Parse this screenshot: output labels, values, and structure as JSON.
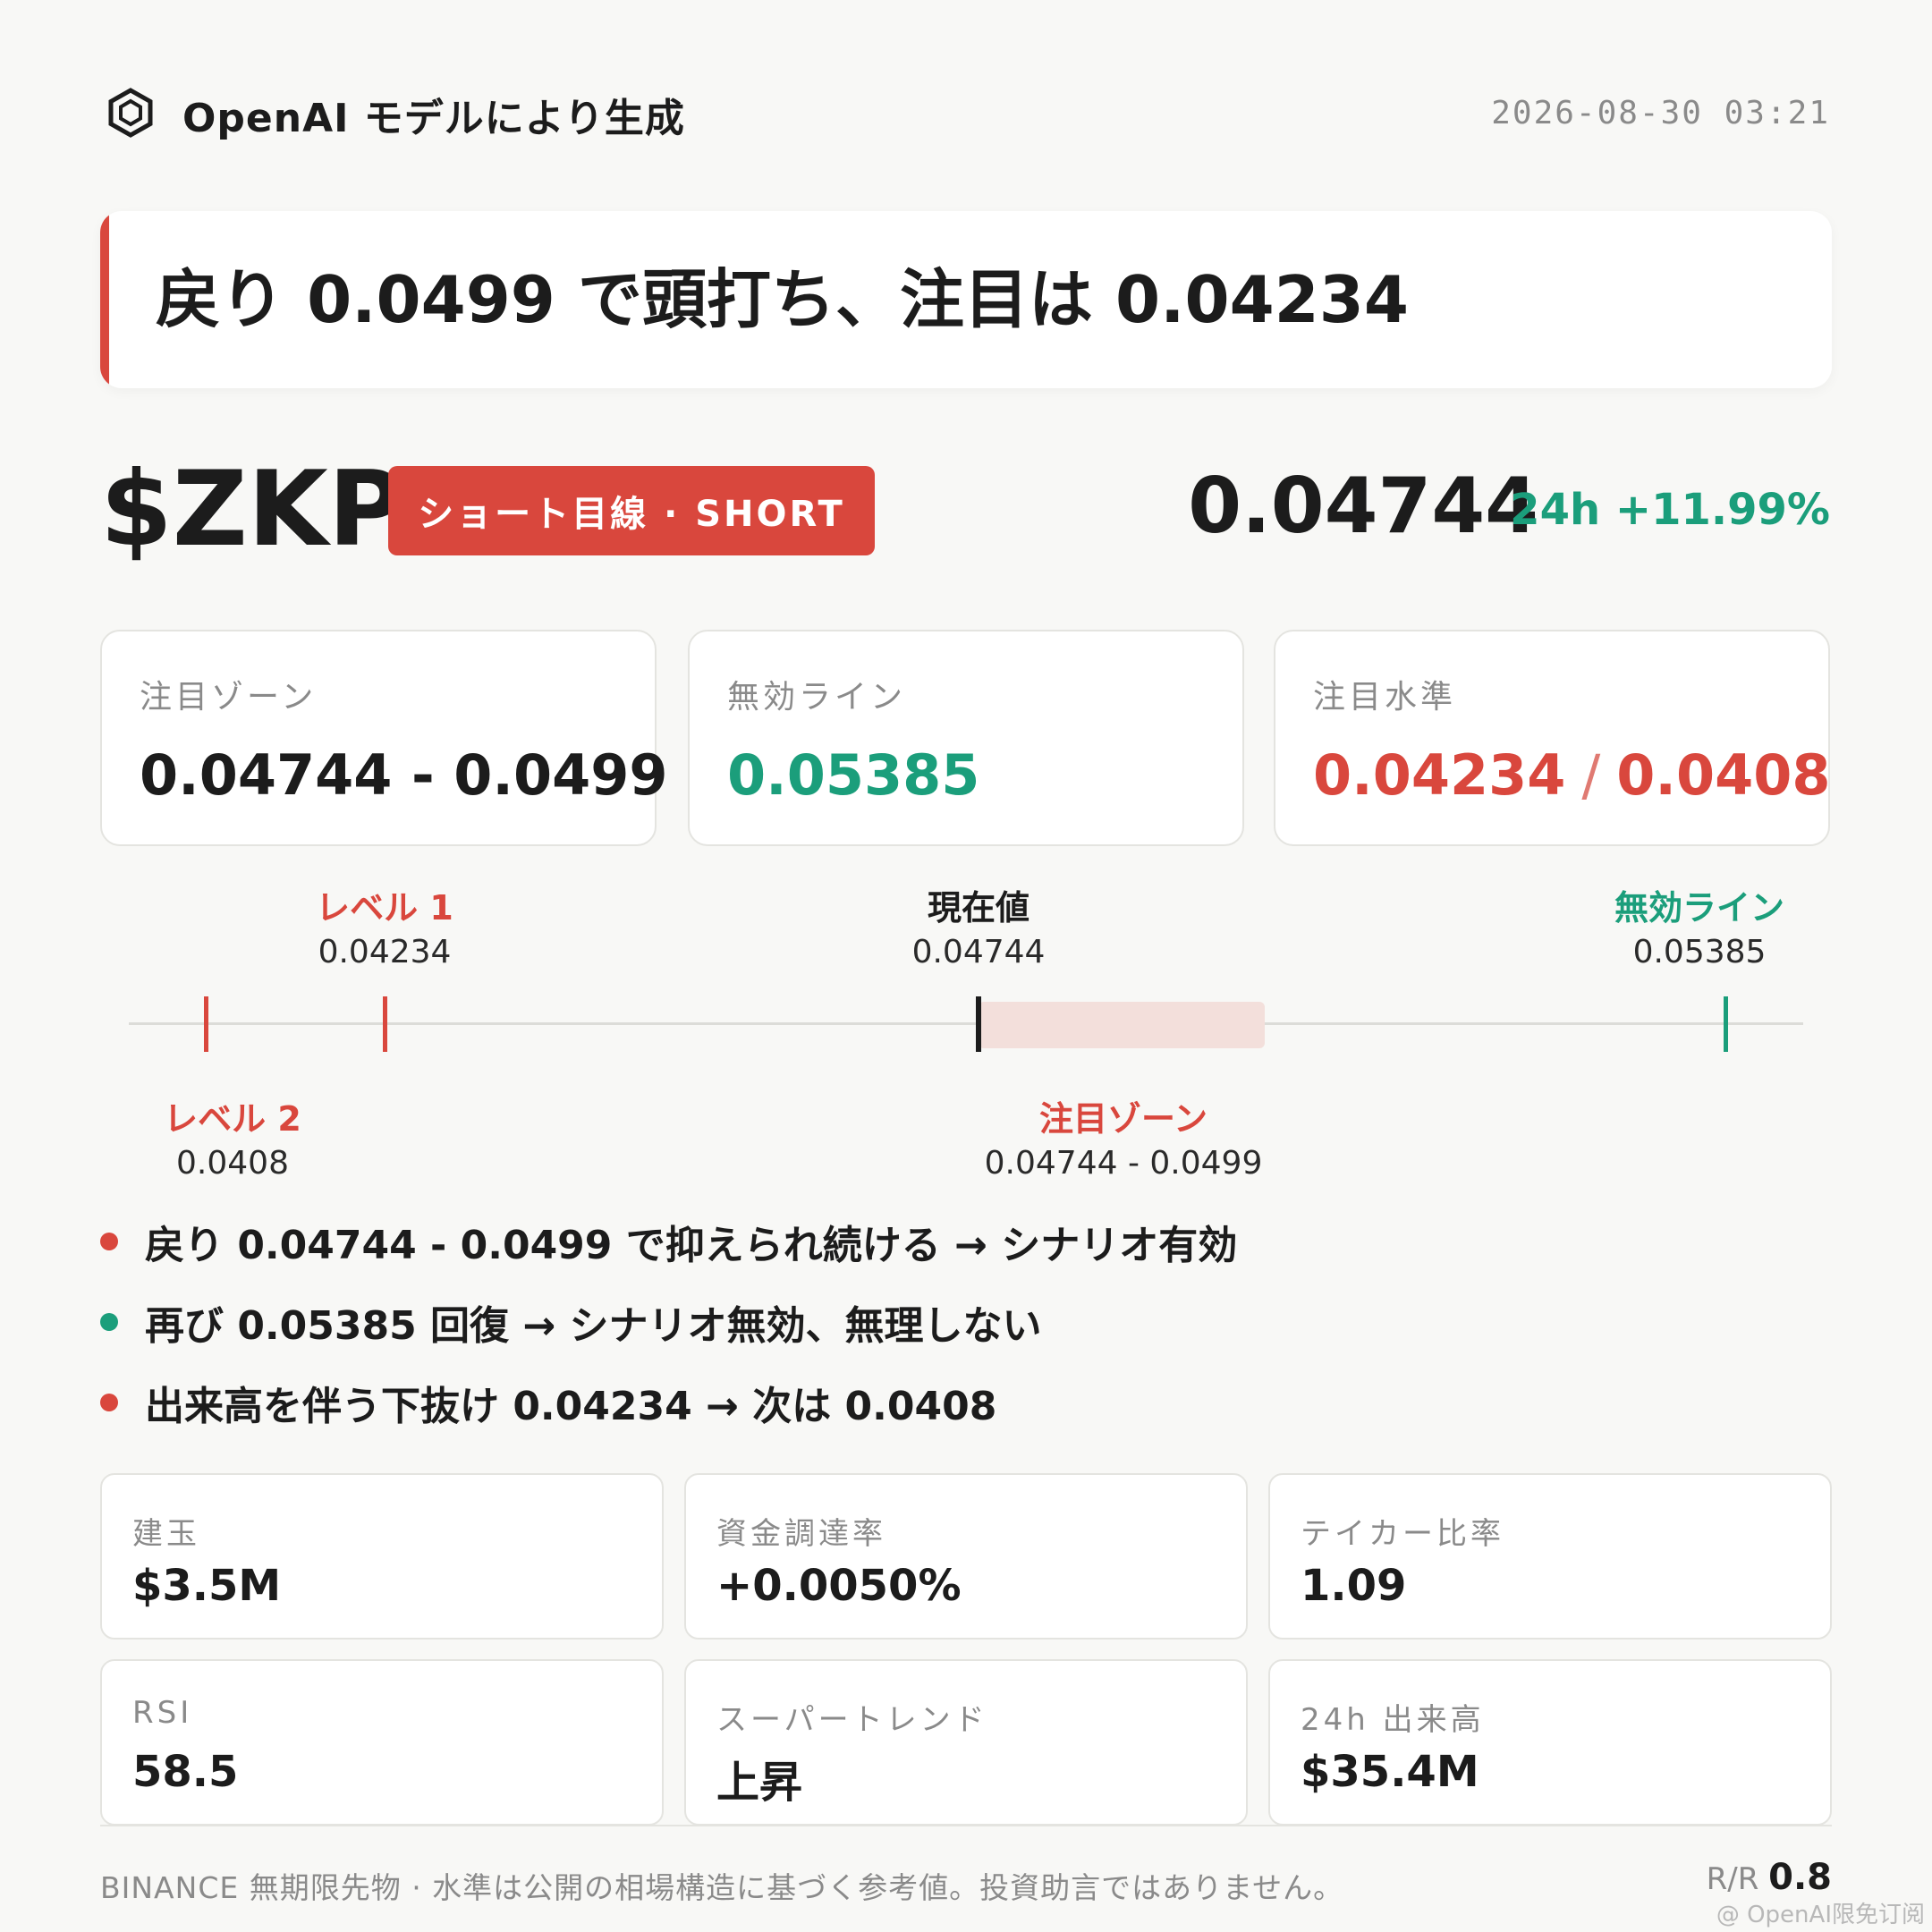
{
  "header": {
    "logo_icon": "hexagon-logo-icon",
    "title": "OpenAI モデルにより生成",
    "timestamp": "2026-08-30 03:21"
  },
  "headline": "戻り 0.0499 で頭打ち、注目は 0.04234",
  "ticker": {
    "symbol": "$ZKP",
    "badge": "ショート目線 · SHORT",
    "price": "0.04744",
    "change": "24h +11.99%"
  },
  "level_cards": [
    {
      "label": "注目ゾーン",
      "value": "0.04744 - 0.0499"
    },
    {
      "label": "無効ライン",
      "value": "0.05385"
    },
    {
      "label": "注目水準",
      "value_1": "0.04234",
      "separator": "/",
      "value_2": "0.0408"
    }
  ],
  "price_line": {
    "level1": {
      "label": "レベル 1",
      "value": "0.04234"
    },
    "current": {
      "label": "現在値",
      "value": "0.04744"
    },
    "invalid": {
      "label": "無効ライン",
      "value": "0.05385"
    },
    "level2": {
      "label": "レベル 2",
      "value": "0.0408"
    },
    "zone": {
      "label": "注目ゾーン",
      "value": "0.04744 - 0.0499"
    }
  },
  "bullets": [
    {
      "text": "戻り 0.04744 - 0.0499 で抑えられ続ける → シナリオ有効",
      "color": "#d9473d"
    },
    {
      "text": "再び 0.05385 回復 → シナリオ無効、無理しない",
      "color": "#1b9e7b"
    },
    {
      "text": "出来高を伴う下抜け 0.04234 → 次は 0.0408",
      "color": "#d9473d"
    }
  ],
  "stats": [
    {
      "label": "建玉",
      "value": "$3.5M"
    },
    {
      "label": "資金調達率",
      "value": "+0.0050%"
    },
    {
      "label": "テイカー比率",
      "value": "1.09"
    },
    {
      "label": "RSI",
      "value": "58.5"
    },
    {
      "label": "スーパートレンド",
      "value": "上昇"
    },
    {
      "label": "24h 出来高",
      "value": "$35.4M"
    }
  ],
  "footer": {
    "disclaimer": "BINANCE 無期限先物 · 水準は公開の相場構造に基づく参考値。投資助言ではありません。",
    "rr_label": "R/R",
    "rr_value": "0.8",
    "watermark": "@ OpenAI限免订阅"
  },
  "colors": {
    "accent_red": "#d9473d",
    "accent_green": "#1b9e7b",
    "zone_fill": "#f3dfdb"
  }
}
